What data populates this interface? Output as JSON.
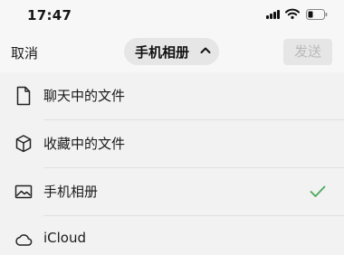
{
  "status_bar": {
    "time": "17:47"
  },
  "header": {
    "cancel_label": "取消",
    "album_title": "手机相册",
    "send_label": "发送"
  },
  "sources": [
    {
      "label": "聊天中的文件",
      "icon": "file-icon",
      "selected": false
    },
    {
      "label": "收藏中的文件",
      "icon": "cube-icon",
      "selected": false
    },
    {
      "label": "手机相册",
      "icon": "image-icon",
      "selected": true
    },
    {
      "label": "iCloud",
      "icon": "cloud-icon",
      "selected": false
    }
  ],
  "colors": {
    "check": "#4aa85a",
    "background": "#f7f7f7",
    "send_disabled_text": "#b9b9b9"
  }
}
